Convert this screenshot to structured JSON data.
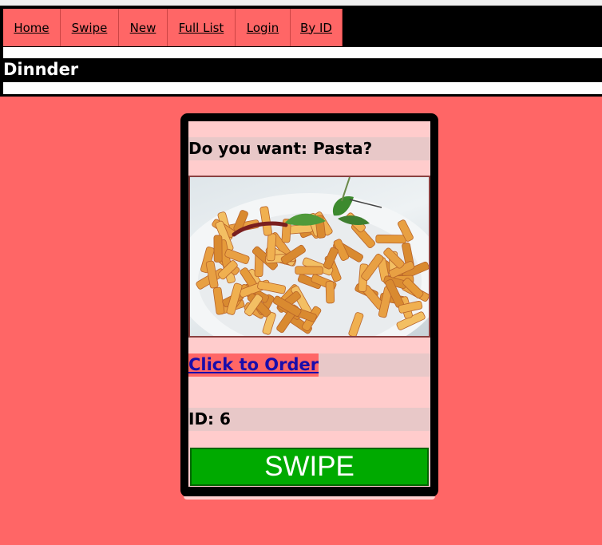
{
  "nav": {
    "items": [
      {
        "label": "Home"
      },
      {
        "label": "Swipe"
      },
      {
        "label": "New"
      },
      {
        "label": "Full List"
      },
      {
        "label": "Login"
      },
      {
        "label": "By ID"
      }
    ]
  },
  "header": {
    "title": "Dinnder"
  },
  "card": {
    "question": "Do you want: Pasta?",
    "image_subject": "pasta-penne-dish",
    "order_link": "Click to Order",
    "id_label": "ID: 6",
    "swipe_label": "SWIPE"
  },
  "colors": {
    "page_bg": "#ff6666",
    "card_bg": "#ffcccc",
    "swipe_button": "#00aa00",
    "link": "#1a0dab"
  }
}
